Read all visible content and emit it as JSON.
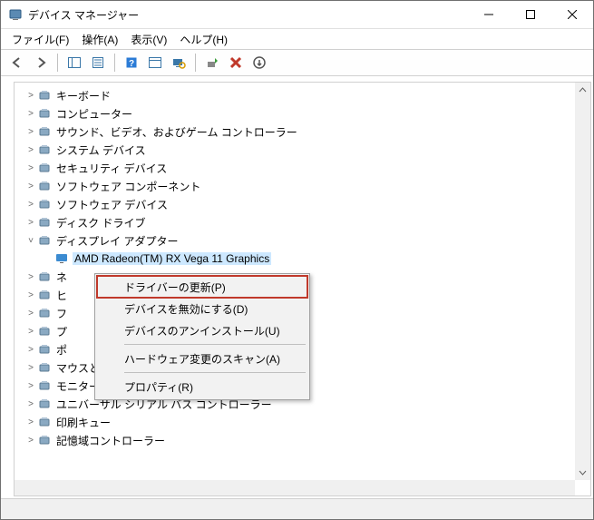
{
  "window": {
    "title": "デバイス マネージャー"
  },
  "menu": {
    "file": "ファイル(F)",
    "action": "操作(A)",
    "view": "表示(V)",
    "help": "ヘルプ(H)"
  },
  "tree": {
    "items": [
      {
        "label": "キーボード"
      },
      {
        "label": "コンピューター"
      },
      {
        "label": "サウンド、ビデオ、およびゲーム コントローラー"
      },
      {
        "label": "システム デバイス"
      },
      {
        "label": "セキュリティ デバイス"
      },
      {
        "label": "ソフトウェア コンポーネント"
      },
      {
        "label": "ソフトウェア デバイス"
      },
      {
        "label": "ディスク ドライブ"
      },
      {
        "label": "ディスプレイ アダプター"
      },
      {
        "label": "ネ"
      },
      {
        "label": "ヒ"
      },
      {
        "label": "フ"
      },
      {
        "label": "プ"
      },
      {
        "label": "ポ"
      },
      {
        "label": "マウスとそのほかのポインティング デバイス"
      },
      {
        "label": "モニター"
      },
      {
        "label": "ユニバーサル シリアル バス コントローラー"
      },
      {
        "label": "印刷キュー"
      },
      {
        "label": "記憶域コントローラー"
      }
    ],
    "selected_child": {
      "label": "AMD Radeon(TM) RX Vega 11 Graphics"
    }
  },
  "context_menu": {
    "items": [
      {
        "label": "ドライバーの更新(P)",
        "hl": true
      },
      {
        "label": "デバイスを無効にする(D)"
      },
      {
        "label": "デバイスのアンインストール(U)"
      },
      {
        "sep": true
      },
      {
        "label": "ハードウェア変更のスキャン(A)"
      },
      {
        "sep": true
      },
      {
        "label": "プロパティ(R)"
      }
    ]
  }
}
